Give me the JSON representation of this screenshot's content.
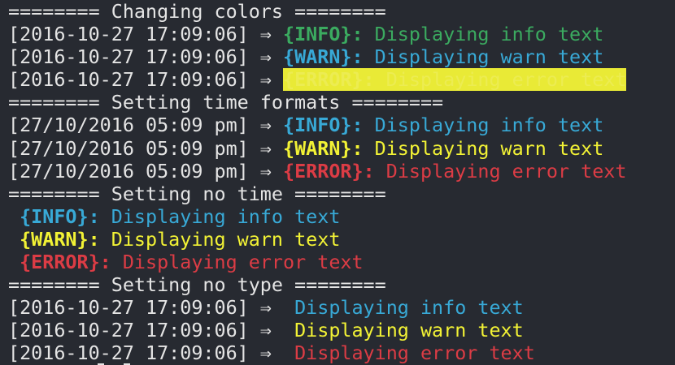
{
  "terminal": {
    "colors": {
      "background": "#272a31",
      "default": "#e4e4e4",
      "green": "#3bab60",
      "blue": "#38a9d6",
      "yellow": "#f2f235",
      "red": "#dc3c45",
      "yellow_highlight": "#e9ea36"
    },
    "lines": [
      {
        "text": "======== Changing colors ========"
      },
      {
        "prefix": "[2016-10-27 17:09:06] ⇒ ",
        "tag": "{INFO}:",
        "message": " Displaying info text"
      },
      {
        "prefix": "[2016-10-27 17:09:06] ⇒ ",
        "tag": "{WARN}:",
        "message": " Displaying warn text"
      },
      {
        "prefix": "[2016-10-27 17:09:06] ⇒ ",
        "tag": "{ERROR}:",
        "message": " Displaying error text"
      },
      {
        "text": "======== Setting time formats ========"
      },
      {
        "prefix": "[27/10/2016 05:09 pm] ⇒ ",
        "tag": "{INFO}:",
        "message": " Displaying info text"
      },
      {
        "prefix": "[27/10/2016 05:09 pm] ⇒ ",
        "tag": "{WARN}:",
        "message": " Displaying warn text"
      },
      {
        "prefix": "[27/10/2016 05:09 pm] ⇒ ",
        "tag": "{ERROR}:",
        "message": " Displaying error text"
      },
      {
        "text": "======== Setting no time ========"
      },
      {
        "prefix": " ",
        "tag": "{INFO}:",
        "message": " Displaying info text"
      },
      {
        "prefix": " ",
        "tag": "{WARN}:",
        "message": " Displaying warn text"
      },
      {
        "prefix": " ",
        "tag": "{ERROR}:",
        "message": " Displaying error text"
      },
      {
        "text": "======== Setting no type ========"
      },
      {
        "prefix": "[2016-10-27 17:09:06] ⇒ ",
        "message": " Displaying info text"
      },
      {
        "prefix": "[2016-10-27 17:09:06] ⇒ ",
        "message": " Displaying warn text"
      },
      {
        "prefix": "[2016-10-27 17:09:06] ⇒ ",
        "message": " Displaying error text"
      }
    ]
  }
}
